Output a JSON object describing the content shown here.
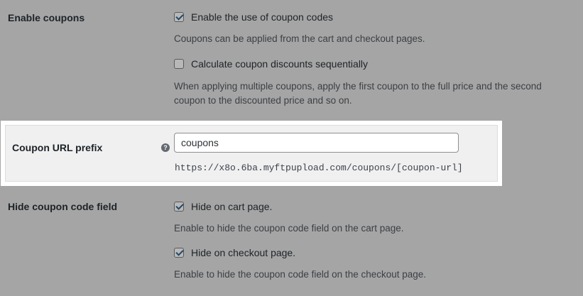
{
  "enable_coupons": {
    "label": "Enable coupons",
    "option1": {
      "label": "Enable the use of coupon codes",
      "checked": true
    },
    "option1_desc": "Coupons can be applied from the cart and checkout pages.",
    "option2": {
      "label": "Calculate coupon discounts sequentially",
      "checked": false
    },
    "option2_desc_line1": "When applying multiple coupons, apply the first coupon to the full price and the second",
    "option2_desc_line2": "coupon to the discounted price and so on."
  },
  "coupon_url_prefix": {
    "label": "Coupon URL prefix",
    "help_glyph": "?",
    "value": "coupons",
    "preview_url": "https://x8o.6ba.myftpupload.com/coupons/[coupon-url]"
  },
  "hide_coupon_field": {
    "label": "Hide coupon code field",
    "cart": {
      "label": "Hide on cart page.",
      "checked": true
    },
    "cart_desc": "Enable to hide the coupon code field on the cart page.",
    "checkout": {
      "label": "Hide on checkout page.",
      "checked": true
    },
    "checkout_desc": "Enable to hide the coupon code field on the checkout page."
  },
  "colors": {
    "overlay": "#a5a5a5",
    "highlight_bg": "#ffffff",
    "checkbox_check": "#1f4a6a"
  }
}
